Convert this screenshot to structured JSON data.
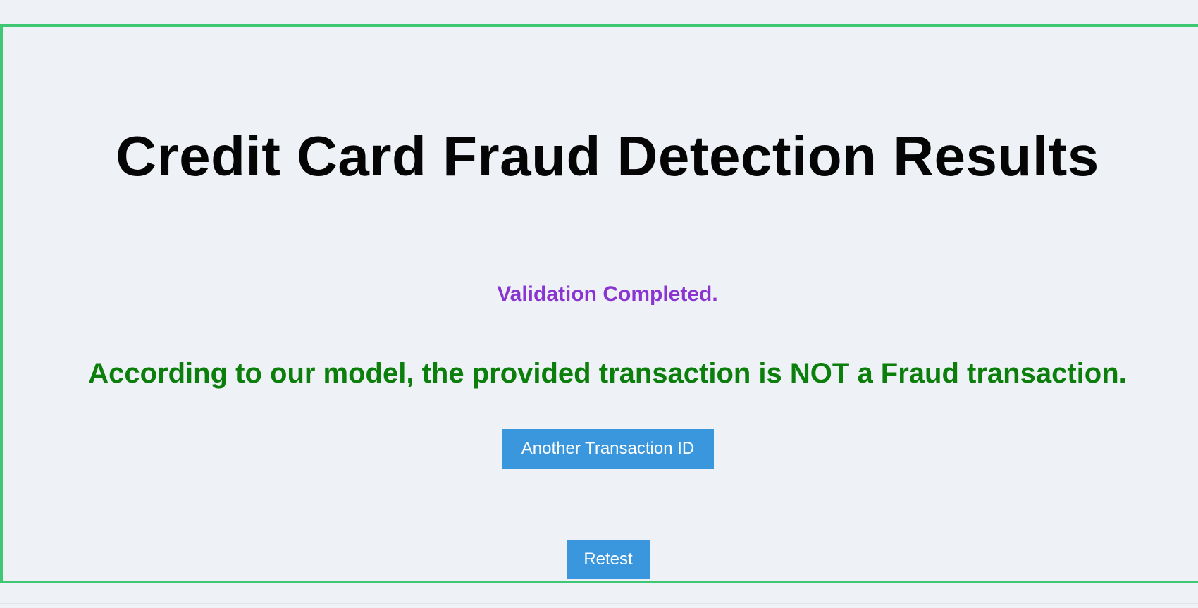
{
  "page": {
    "title": "Credit Card Fraud Detection Results",
    "validation_status": "Validation Completed.",
    "result_message": "According to our model, the provided transaction is NOT a Fraud transaction."
  },
  "actions": {
    "another_transaction_label": "Another Transaction ID",
    "retest_label": "Retest"
  },
  "colors": {
    "background": "#eef2f6",
    "frame_border": "#3fc874",
    "title": "#050505",
    "validation_status": "#8a35d2",
    "result_message": "#0b7e0b",
    "button_background": "#3a97dd",
    "button_text": "#ffffff"
  }
}
